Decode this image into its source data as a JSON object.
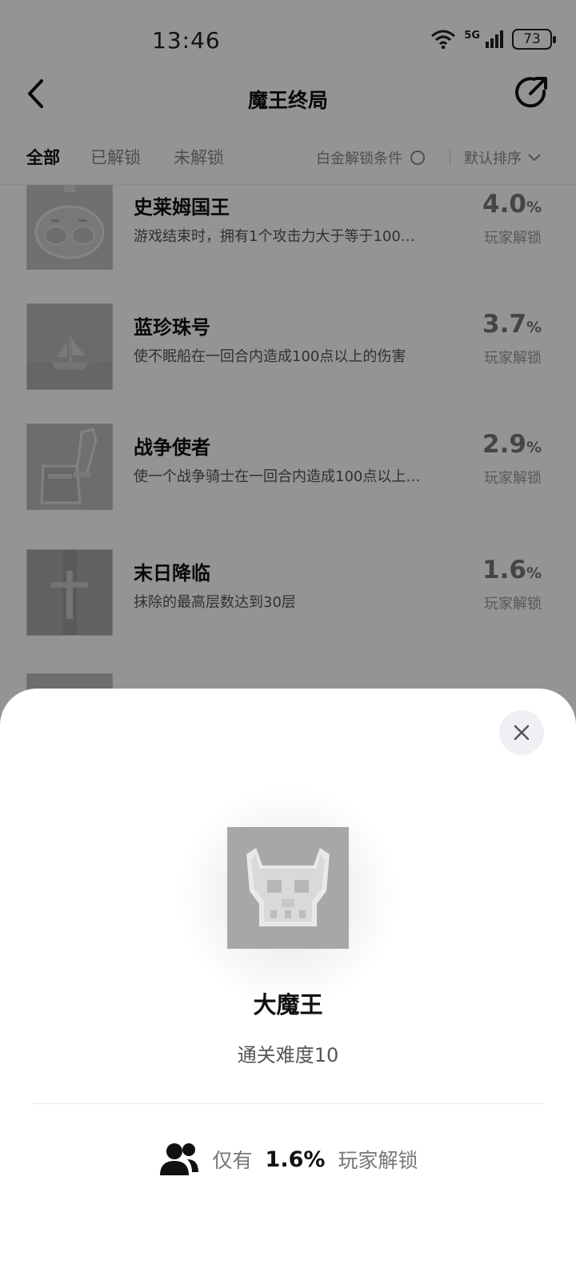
{
  "status_bar": {
    "time": "13:46",
    "network": "5G",
    "battery": "73"
  },
  "header": {
    "title": "魔王终局"
  },
  "filters": {
    "tabs": [
      {
        "label": "全部"
      },
      {
        "label": "已解锁"
      },
      {
        "label": "未解锁"
      }
    ],
    "platinum_condition": "白金解锁条件",
    "sort": "默认排序"
  },
  "achievements": [
    {
      "title": "史莱姆国王",
      "desc": "游戏结束时，拥有1个攻击力大于等于100…",
      "pct": "4.0",
      "pct_unit": "%",
      "sub": "玩家解锁",
      "icon": "slime-king-icon"
    },
    {
      "title": "蓝珍珠号",
      "desc": "使不眠船在一回合内造成100点以上的伤害",
      "pct": "3.7",
      "pct_unit": "%",
      "sub": "玩家解锁",
      "icon": "ship-icon"
    },
    {
      "title": "战争使者",
      "desc": "使一个战争骑士在一回合内造成100点以上…",
      "pct": "2.9",
      "pct_unit": "%",
      "sub": "玩家解锁",
      "icon": "armor-sword-icon"
    },
    {
      "title": "末日降临",
      "desc": "抹除的最高层数达到30层",
      "pct": "1.6",
      "pct_unit": "%",
      "sub": "玩家解锁",
      "icon": "cross-icon"
    }
  ],
  "sheet": {
    "title": "大魔王",
    "desc": "通关难度10",
    "stat_prefix": "仅有",
    "stat_value": "1.6%",
    "stat_suffix": "玩家解锁"
  }
}
